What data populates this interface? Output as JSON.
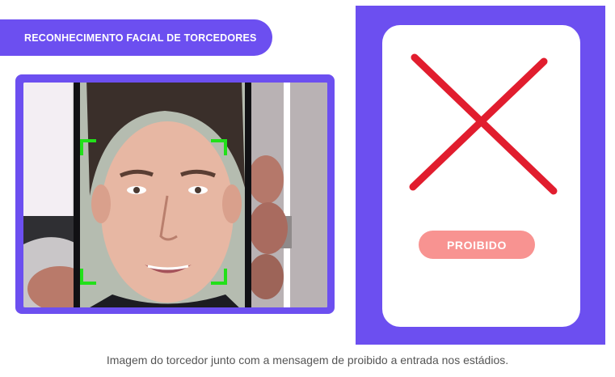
{
  "header": {
    "title": "RECONHECIMENTO FACIAL DE TORCEDORES"
  },
  "result": {
    "status_label": "PROIBIDO"
  },
  "caption": "Imagem do torcedor junto com a mensagem de proibido a entrada nos estádios.",
  "colors": {
    "accent": "#6c4ff0",
    "cross": "#e11d2e",
    "status_badge": "#f89391",
    "detection_bracket": "#22e01a"
  },
  "icons": [
    "face-detection-bracket-icon",
    "cross-x-icon"
  ]
}
